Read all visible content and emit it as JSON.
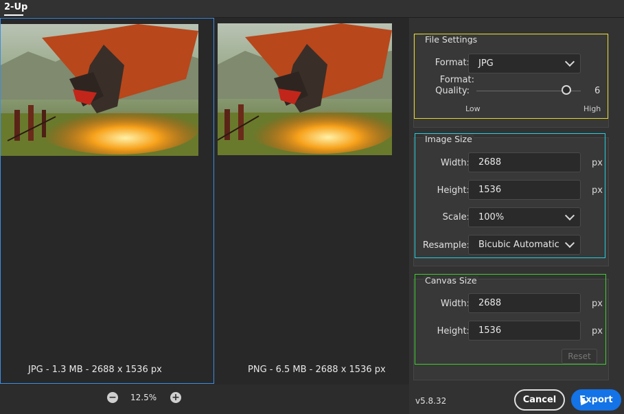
{
  "tabs": [
    {
      "label": "2-Up",
      "active": true
    }
  ],
  "previews": {
    "left": {
      "caption": "JPG - 1.3 MB - 2688 x 1536 px",
      "selected": true
    },
    "right": {
      "caption": "PNG - 6.5 MB - 2688 x 1536 px",
      "selected": false
    }
  },
  "zoom": {
    "value": "12.5%",
    "minus_icon": "zoom-out-icon",
    "plus_icon": "zoom-in-icon"
  },
  "file_settings": {
    "title": "File Settings",
    "format_label": "Format:",
    "format_value": "JPG",
    "quality_label": "Quality:",
    "quality_value": "6",
    "quality_fraction": 0.86,
    "low_label": "Low",
    "high_label": "High"
  },
  "image_size": {
    "title": "Image Size",
    "width_label": "Width:",
    "width_value": "2688",
    "width_unit": "px",
    "height_label": "Height:",
    "height_value": "1536",
    "height_unit": "px",
    "scale_label": "Scale:",
    "scale_value": "100%",
    "resample_label": "Resample:",
    "resample_value": "Bicubic Automatic"
  },
  "canvas_size": {
    "title": "Canvas Size",
    "width_label": "Width:",
    "width_value": "2688",
    "width_unit": "px",
    "height_label": "Height:",
    "height_value": "1536",
    "height_unit": "px",
    "reset_label": "Reset"
  },
  "footer": {
    "version": "v5.8.32",
    "cancel_label": "Cancel",
    "export_label": "Export"
  },
  "colors": {
    "accent": "#1473e6",
    "highlight_yellow": "#e8d829",
    "highlight_cyan": "#25d0e0",
    "highlight_green": "#3fcf2e"
  }
}
